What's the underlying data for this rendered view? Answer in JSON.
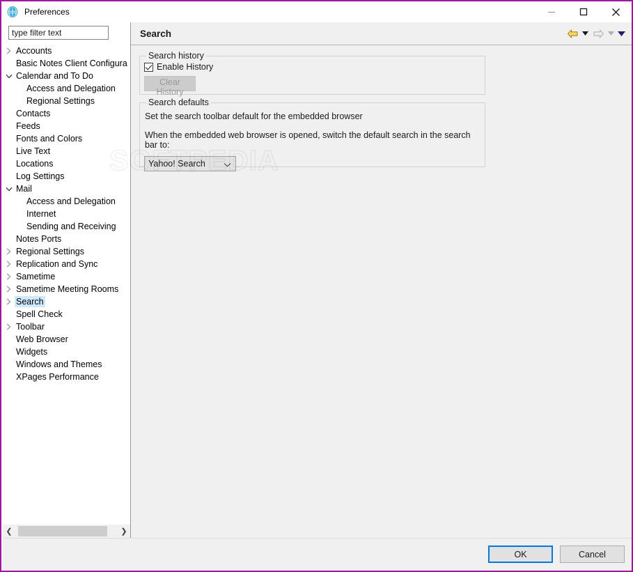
{
  "window": {
    "title": "Preferences",
    "icon": "notes-app-icon",
    "border_color": "#A0179F",
    "controls": {
      "minimize": "minimize-icon",
      "maximize": "maximize-icon",
      "close": "close-icon"
    }
  },
  "sidebar": {
    "filter": {
      "value": "type filter text",
      "placeholder": "type filter text"
    },
    "items": [
      {
        "label": "Accounts",
        "level": 0,
        "state": "collapsed",
        "selected": false
      },
      {
        "label": "Basic Notes Client Configura",
        "level": 0,
        "state": "leaf",
        "selected": false
      },
      {
        "label": "Calendar and To Do",
        "level": 0,
        "state": "expanded",
        "selected": false
      },
      {
        "label": "Access and Delegation",
        "level": 1,
        "state": "leaf",
        "selected": false
      },
      {
        "label": "Regional Settings",
        "level": 1,
        "state": "leaf",
        "selected": false
      },
      {
        "label": "Contacts",
        "level": 0,
        "state": "leaf",
        "selected": false
      },
      {
        "label": "Feeds",
        "level": 0,
        "state": "leaf",
        "selected": false
      },
      {
        "label": "Fonts and Colors",
        "level": 0,
        "state": "leaf",
        "selected": false
      },
      {
        "label": "Live Text",
        "level": 0,
        "state": "leaf",
        "selected": false
      },
      {
        "label": "Locations",
        "level": 0,
        "state": "leaf",
        "selected": false
      },
      {
        "label": "Log Settings",
        "level": 0,
        "state": "leaf",
        "selected": false
      },
      {
        "label": "Mail",
        "level": 0,
        "state": "expanded",
        "selected": false
      },
      {
        "label": "Access and Delegation",
        "level": 1,
        "state": "leaf",
        "selected": false
      },
      {
        "label": "Internet",
        "level": 1,
        "state": "leaf",
        "selected": false
      },
      {
        "label": "Sending and Receiving",
        "level": 1,
        "state": "leaf",
        "selected": false
      },
      {
        "label": "Notes Ports",
        "level": 0,
        "state": "leaf",
        "selected": false
      },
      {
        "label": "Regional Settings",
        "level": 0,
        "state": "collapsed",
        "selected": false
      },
      {
        "label": "Replication and Sync",
        "level": 0,
        "state": "collapsed",
        "selected": false
      },
      {
        "label": "Sametime",
        "level": 0,
        "state": "collapsed",
        "selected": false
      },
      {
        "label": "Sametime Meeting Rooms",
        "level": 0,
        "state": "collapsed",
        "selected": false
      },
      {
        "label": "Search",
        "level": 0,
        "state": "collapsed",
        "selected": true
      },
      {
        "label": "Spell Check",
        "level": 0,
        "state": "leaf",
        "selected": false
      },
      {
        "label": "Toolbar",
        "level": 0,
        "state": "collapsed",
        "selected": false
      },
      {
        "label": "Web Browser",
        "level": 0,
        "state": "leaf",
        "selected": false
      },
      {
        "label": "Widgets",
        "level": 0,
        "state": "leaf",
        "selected": false
      },
      {
        "label": "Windows and Themes",
        "level": 0,
        "state": "leaf",
        "selected": false
      },
      {
        "label": "XPages Performance",
        "level": 0,
        "state": "leaf",
        "selected": false
      }
    ],
    "scrollbar": {
      "left_arrow": "chevron-left-icon",
      "right_arrow": "chevron-right-icon"
    }
  },
  "page": {
    "title": "Search",
    "nav": {
      "back_icon": "back-arrow-icon",
      "back_color": "#E8B421",
      "back_menu_icon": "caret-down-icon",
      "forward_icon": "forward-arrow-icon",
      "forward_color": "#D4D0C8",
      "forward_menu_icon": "caret-down-icon",
      "view_menu_icon": "caret-down-icon",
      "view_menu_color": "#2B1A66"
    },
    "search_history": {
      "group_title": "Search history",
      "enable_history": {
        "label": "Enable History",
        "checked": true
      },
      "clear_history": {
        "label": "Clear History",
        "enabled": false
      }
    },
    "search_defaults": {
      "group_title": "Search defaults",
      "line1": "Set the search toolbar default for the embedded browser",
      "line2": "When the embedded web browser is opened, switch the default search in the search bar to:",
      "engine_select": {
        "value": "Yahoo! Search",
        "caret_icon": "chevron-down-icon"
      }
    },
    "watermark": "SOFTPEDIA"
  },
  "footer": {
    "ok_label": "OK",
    "cancel_label": "Cancel"
  }
}
